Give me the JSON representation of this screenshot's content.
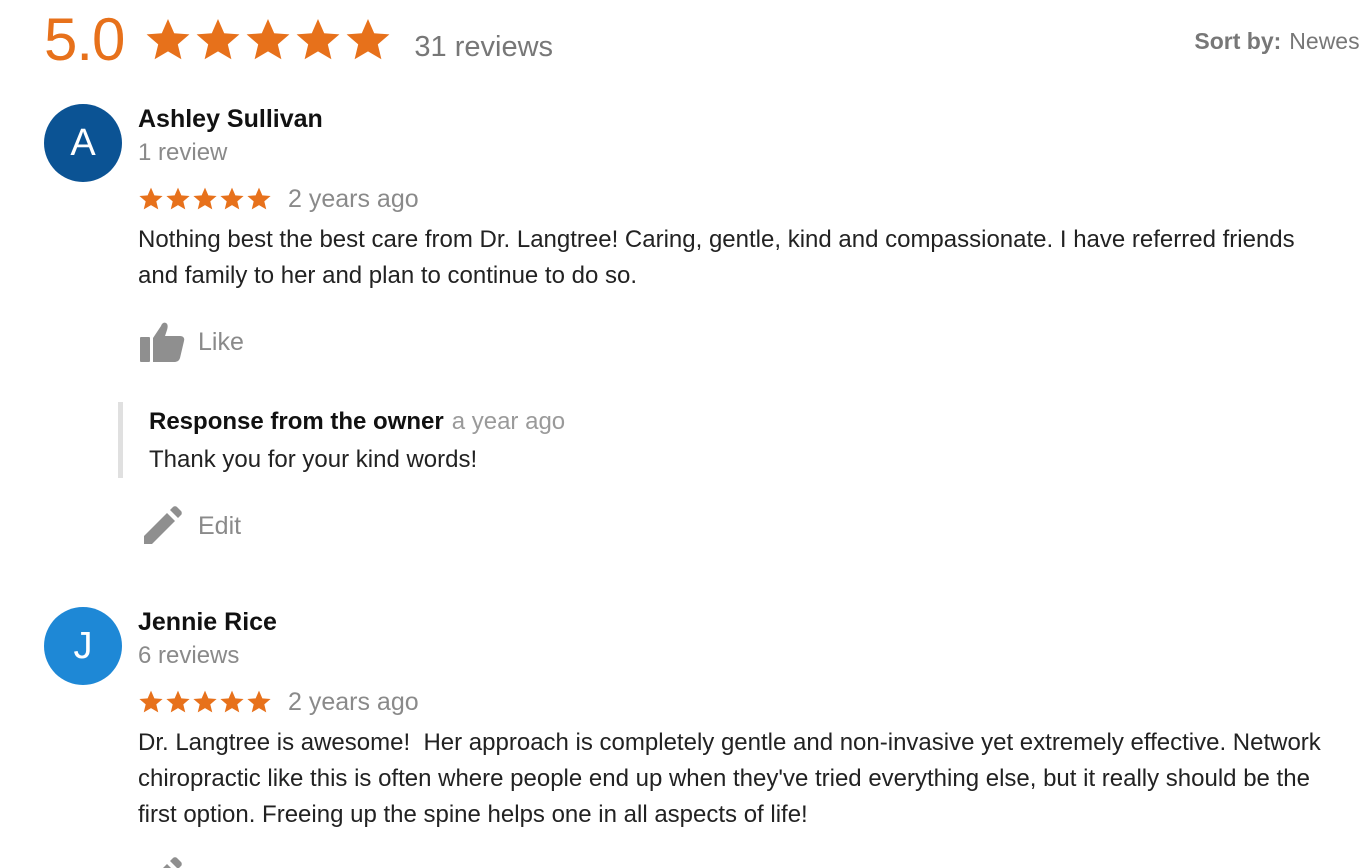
{
  "summary": {
    "rating": "5.0",
    "stars": 5,
    "review_count": "31 reviews",
    "star_color": "#e7711b",
    "sort_label": "Sort by:",
    "sort_value": "Newest"
  },
  "reviews": [
    {
      "avatar_letter": "A",
      "avatar_color": "#0b5394",
      "name": "Ashley Sullivan",
      "count": "1 review",
      "stars": 5,
      "date": "2 years ago",
      "text": "Nothing best the best care from Dr. Langtree! Caring, gentle, kind and compassionate. I have referred friends and family to her and plan to continue to do so.",
      "like_label": "Like",
      "owner_response": {
        "title": "Response from the owner",
        "date": "a year ago",
        "text": "Thank you for your kind words!"
      },
      "edit_label": "Edit"
    },
    {
      "avatar_letter": "J",
      "avatar_color": "#1e88d6",
      "name": "Jennie Rice",
      "count": "6 reviews",
      "stars": 5,
      "date": "2 years ago",
      "text": "Dr. Langtree is awesome!  Her approach is completely gentle and non-invasive yet extremely effective. Network chiropractic like this is often where people end up when they've tried everything else, but it really should be the first option. Freeing up the spine helps one in all aspects of life!"
    }
  ]
}
